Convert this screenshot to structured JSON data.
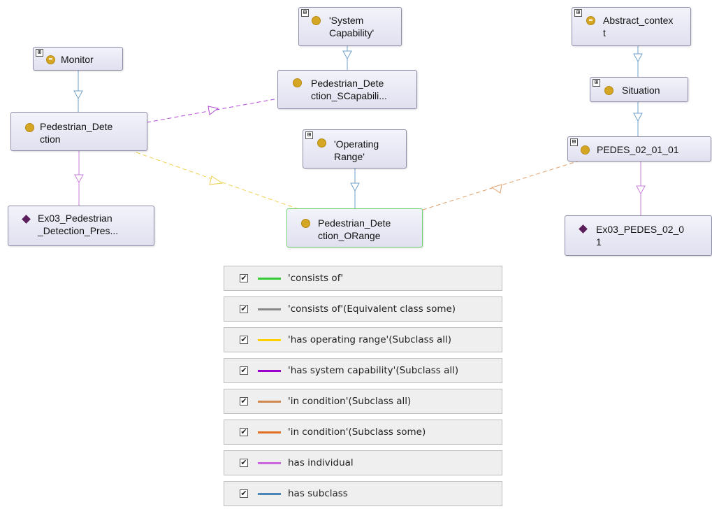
{
  "graph": {
    "nodes": [
      {
        "id": "monitor",
        "label": "Monitor",
        "expand": "⊞",
        "bullet": "eq"
      },
      {
        "id": "system-capability",
        "label": "'System\nCapability'",
        "expand": "⊞",
        "bullet": "plain"
      },
      {
        "id": "abstract-context",
        "label": "Abstract_contex\nt",
        "expand": "⊞",
        "bullet": "eq"
      },
      {
        "id": "pedestrian-detection-scapability",
        "label": "Pedestrian_Dete\nction_SCapabili...",
        "expand": "",
        "bullet": "plain"
      },
      {
        "id": "situation",
        "label": "Situation",
        "expand": "⊞",
        "bullet": "plain"
      },
      {
        "id": "pedestrian-detection",
        "label": "Pedestrian_Dete\nction",
        "expand": "",
        "bullet": "plain"
      },
      {
        "id": "operating-range",
        "label": "'Operating\nRange'",
        "expand": "⊞",
        "bullet": "plain"
      },
      {
        "id": "pedes-02-01-01",
        "label": "PEDES_02_01_01",
        "expand": "⊞",
        "bullet": "plain"
      },
      {
        "id": "ex03-pedestrian",
        "label": "Ex03_Pedestrian\n_Detection_Pres...",
        "expand": "",
        "bullet": "diamond"
      },
      {
        "id": "pedestrian-detection-orange",
        "label": "Pedestrian_Dete\nction_ORange",
        "expand": "",
        "bullet": "plain",
        "selected": true
      },
      {
        "id": "ex03-pedes",
        "label": "Ex03_PEDES_02_0\n1",
        "expand": "",
        "bullet": "diamond"
      }
    ],
    "edge_colors": {
      "has_subclass": "#6f9fc8",
      "has_individual": "#c77fd9",
      "has_system_capability": "#b44ad8",
      "has_operating_range": "#f0d050",
      "in_condition": "#e0a06a"
    }
  },
  "legend": {
    "checkmark": "✔",
    "items": [
      {
        "label": "'consists of'",
        "color": "#33cc33",
        "checked": true
      },
      {
        "label": "'consists of'(Equivalent class some)",
        "color": "#888888",
        "checked": true
      },
      {
        "label": "'has operating range'(Subclass all)",
        "color": "#ffd000",
        "checked": true
      },
      {
        "label": "'has system capability'(Subclass all)",
        "color": "#9900cc",
        "checked": true
      },
      {
        "label": "'in condition'(Subclass all)",
        "color": "#d08850",
        "checked": true
      },
      {
        "label": "'in condition'(Subclass some)",
        "color": "#e07020",
        "checked": true
      },
      {
        "label": "has individual",
        "color": "#cc66dd",
        "checked": true
      },
      {
        "label": "has subclass",
        "color": "#4a86b8",
        "checked": true
      }
    ]
  }
}
